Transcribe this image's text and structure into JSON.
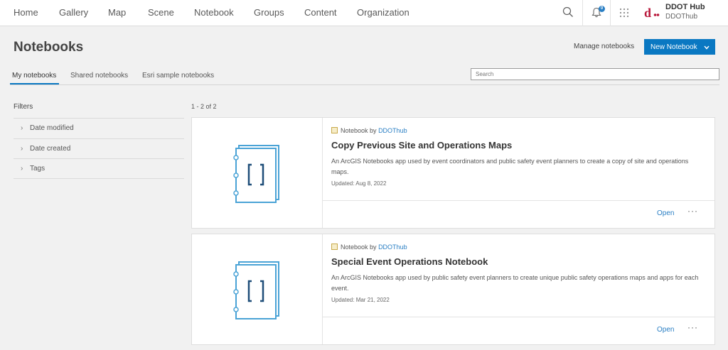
{
  "nav": {
    "links": [
      "Home",
      "Gallery",
      "Map",
      "Scene",
      "Notebook",
      "Groups",
      "Content",
      "Organization"
    ],
    "notification_count": "0",
    "user": {
      "name": "DDOT Hub",
      "handle": "DDOThub"
    }
  },
  "page": {
    "title": "Notebooks",
    "manage_label": "Manage notebooks",
    "new_label": "New Notebook"
  },
  "tabs": [
    {
      "label": "My notebooks",
      "active": true
    },
    {
      "label": "Shared notebooks",
      "active": false
    },
    {
      "label": "Esri sample notebooks",
      "active": false
    }
  ],
  "search": {
    "placeholder": "Search"
  },
  "filters": {
    "title": "Filters",
    "items": [
      "Date modified",
      "Date created",
      "Tags"
    ]
  },
  "results": {
    "count_label": "1 - 2 of 2",
    "items": [
      {
        "type_prefix": "Notebook by",
        "owner": "DDOThub",
        "title": "Copy Previous Site and Operations Maps",
        "description": "An ArcGIS Notebooks app used by event coordinators and public safety event planners to create a copy of site and operations maps.",
        "updated": "Updated: Aug 8, 2022",
        "open_label": "Open",
        "more_label": "···"
      },
      {
        "type_prefix": "Notebook by",
        "owner": "DDOThub",
        "title": "Special Event Operations Notebook",
        "description": "An ArcGIS Notebooks app used by public safety event planners to create unique public safety operations maps and apps for each event.",
        "updated": "Updated: Mar 21, 2022",
        "open_label": "Open",
        "more_label": "···"
      }
    ]
  },
  "colors": {
    "accent": "#0a78c2",
    "link": "#2a7fc4",
    "notebook_icon": "#4aa3d6"
  },
  "icons": [
    "search-icon",
    "bell-icon",
    "app-launcher-icon",
    "user-avatar",
    "chevron-down-icon",
    "chevron-right-icon",
    "notebook-icon",
    "notebook-thumbnail"
  ]
}
